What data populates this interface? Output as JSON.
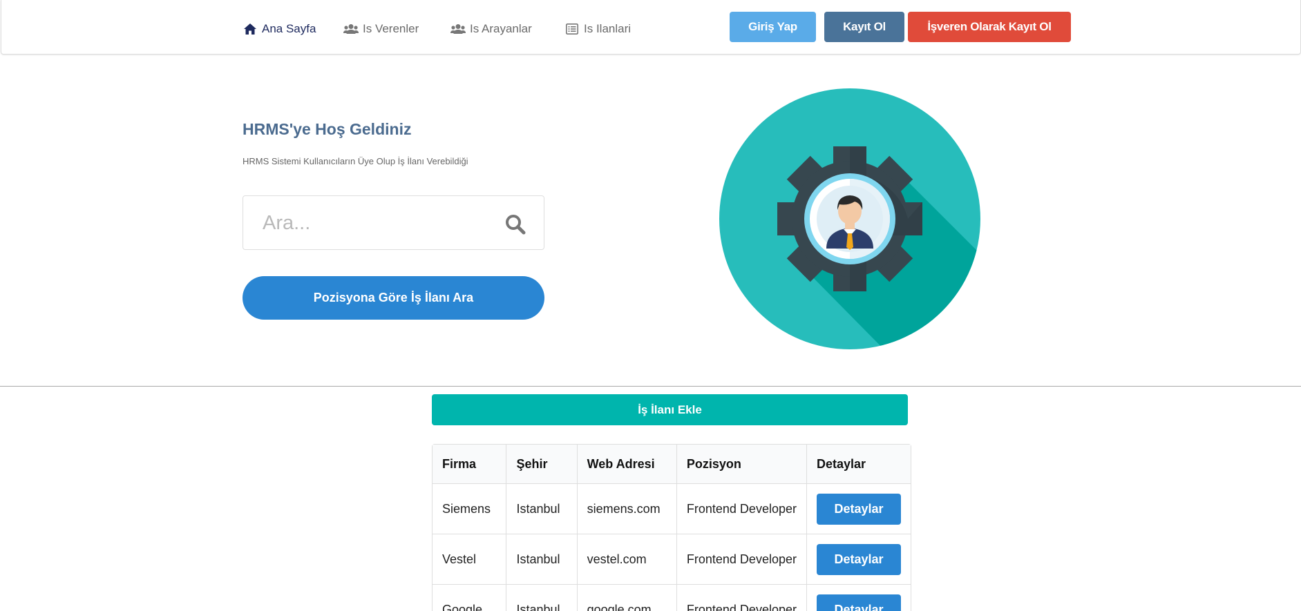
{
  "nav": {
    "items": [
      {
        "label": "Ana Sayfa",
        "icon": "home-icon",
        "active": true
      },
      {
        "label": "Is Verenler",
        "icon": "users-icon",
        "active": false
      },
      {
        "label": "Is Arayanlar",
        "icon": "users-icon",
        "active": false
      },
      {
        "label": "Is Ilanlari",
        "icon": "list-icon",
        "active": false
      }
    ],
    "login_label": "Giriş Yap",
    "register_label": "Kayıt Ol",
    "employer_register_label": "İşveren Olarak Kayıt Ol"
  },
  "hero": {
    "title": "HRMS'ye Hoş Geldiniz",
    "subtitle": "HRMS Sistemi Kullanıcıların Üye Olup İş İlanı Verebildiği",
    "search_placeholder": "Ara...",
    "search_button_label": "Pozisyona Göre İş İlanı Ara",
    "illustration_icon": "user-gear-icon"
  },
  "jobs": {
    "add_button_label": "İş İlanı Ekle",
    "columns": [
      "Firma",
      "Şehir",
      "Web Adresi",
      "Pozisyon",
      "Detaylar"
    ],
    "rows": [
      {
        "company": "Siemens",
        "city": "Istanbul",
        "web": "siemens.com",
        "position": "Frontend Developer",
        "action": "Detaylar"
      },
      {
        "company": "Vestel",
        "city": "Istanbul",
        "web": "vestel.com",
        "position": "Frontend Developer",
        "action": "Detaylar"
      },
      {
        "company": "Google",
        "city": "Istanbul",
        "web": "google.com",
        "position": "Frontend Developer",
        "action": "Detaylar"
      }
    ]
  },
  "colors": {
    "login": "#5aabe8",
    "register": "#4a7399",
    "employer_register": "#e04b3a",
    "primary_blue": "#2a86d3",
    "teal": "#00b5ad"
  }
}
